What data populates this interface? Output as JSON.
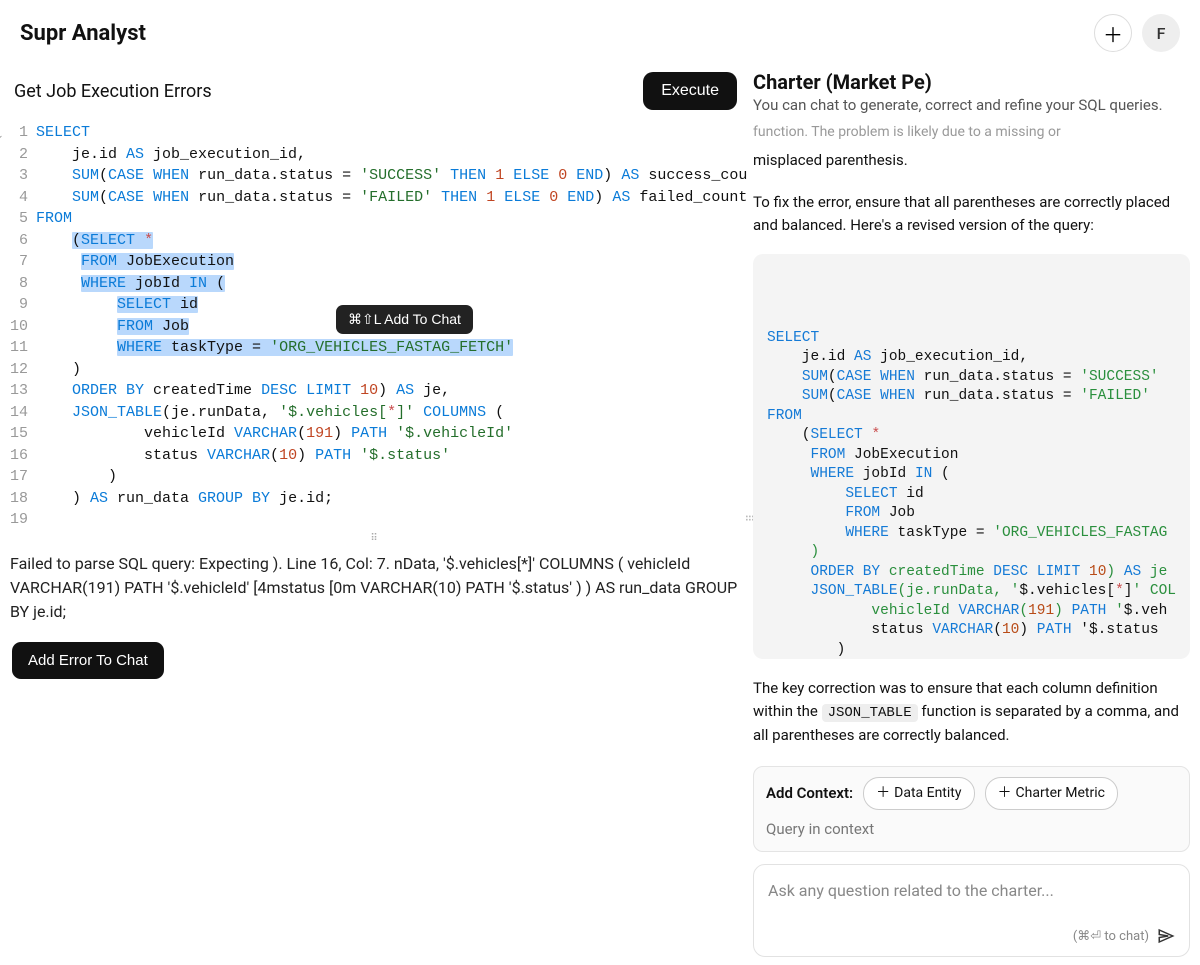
{
  "app": {
    "title": "Supr Analyst",
    "avatar_initial": "F"
  },
  "query": {
    "title": "Get Job Execution Errors",
    "execute_label": "Execute",
    "add_to_chat_label": "⌘⇧L Add To Chat",
    "lines": [
      "SELECT",
      "    je.id AS job_execution_id,",
      "    SUM(CASE WHEN run_data.status = 'SUCCESS' THEN 1 ELSE 0 END) AS success_cou",
      "    SUM(CASE WHEN run_data.status = 'FAILED' THEN 1 ELSE 0 END) AS failed_count",
      "FROM",
      "    (SELECT *",
      "     FROM JobExecution",
      "     WHERE jobId IN (",
      "         SELECT id",
      "         FROM Job",
      "         WHERE taskType = 'ORG_VEHICLES_FASTAG_FETCH'",
      "    )",
      "    ORDER BY createdTime DESC LIMIT 10) AS je,",
      "    JSON_TABLE(je.runData, '$.vehicles[*]' COLUMNS (",
      "            vehicleId VARCHAR(191) PATH '$.vehicleId'",
      "            status VARCHAR(10) PATH '$.status'",
      "        )",
      "    ) AS run_data GROUP BY je.id;",
      ""
    ],
    "line_count": 19
  },
  "error": {
    "message": "Failed to parse SQL query: Expecting ). Line 16, Col: 7. nData, '$.vehicles[*]' COLUMNS ( vehicleId VARCHAR(191) PATH '$.vehicleId'  [4mstatus [0m VARCHAR(10) PATH '$.status' ) ) AS run_data GROUP BY je.id;",
    "add_label": "Add Error To Chat"
  },
  "panel": {
    "title": "Charter (Market Pe)",
    "subtitle": "You can chat to generate, correct and refine your SQL queries.",
    "cut_text": "function. The problem is likely due to a missing or",
    "para1": "misplaced parenthesis.",
    "para2": "To fix the error, ensure that all parentheses are correctly placed and balanced. Here's a revised version of the query:",
    "code_block": "SELECT\n    je.id AS job_execution_id,\n    SUM(CASE WHEN run_data.status = 'SUCCESS'\n    SUM(CASE WHEN run_data.status = 'FAILED' \nFROM\n    (SELECT *\n     FROM JobExecution\n     WHERE jobId IN (\n         SELECT id\n         FROM Job\n         WHERE taskType = 'ORG_VEHICLES_FASTAG\n     )\n     ORDER BY createdTime DESC LIMIT 10) AS je\n     JSON_TABLE(je.runData, '$.vehicles[*]' COL\n            vehicleId VARCHAR(191) PATH '$.veh\n            status VARCHAR(10) PATH '$.status\n        )\n    ) AS run_data\nGROUP BY je.id;",
    "para3_pre": "The key correction was to ensure that each column definition within the ",
    "para3_code": "JSON_TABLE",
    "para3_post": " function is separated by a comma, and all parentheses are correctly balanced.",
    "context_label": "Add Context:",
    "chip1": "Data Entity",
    "chip2": "Charter Metric",
    "context_sub": "Query in context",
    "input_placeholder": "Ask any question related to the charter...",
    "input_hint": "(⌘⏎ to chat)"
  }
}
